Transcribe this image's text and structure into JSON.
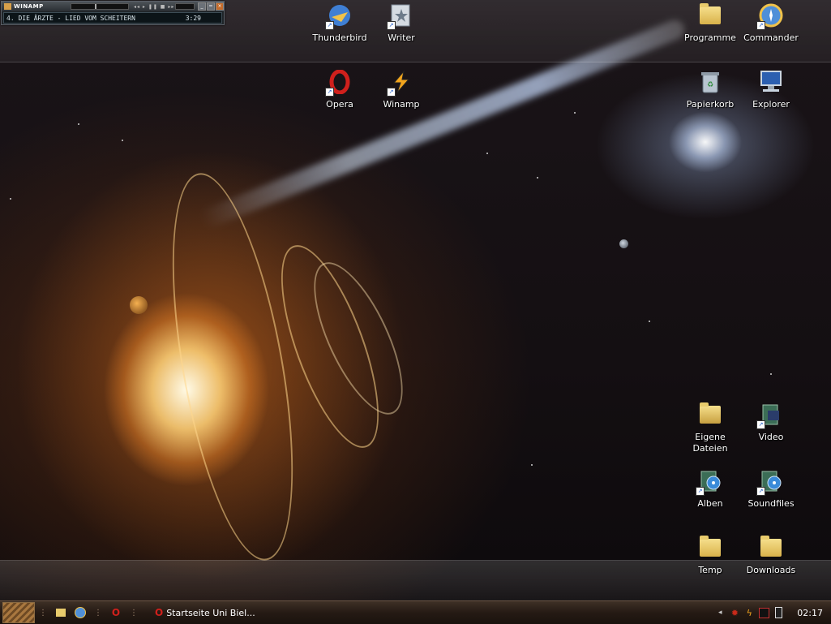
{
  "winamp": {
    "title": "WINAMP",
    "track": "4. DIE ÄRZTE - LIED VOM SCHEITERN",
    "time": "3:29"
  },
  "desktop_icons": {
    "thunderbird": "Thunderbird",
    "writer": "Writer",
    "programme": "Programme",
    "commander": "Commander",
    "opera": "Opera",
    "winamp": "Winamp",
    "papierkorb": "Papierkorb",
    "explorer": "Explorer",
    "eigene_dateien_1": "Eigene",
    "eigene_dateien_2": "Dateien",
    "video": "Video",
    "alben": "Alben",
    "soundfiles": "Soundfiles",
    "temp": "Temp",
    "downloads": "Downloads"
  },
  "taskbar": {
    "task_label": "Startseite Uni Biel...",
    "clock": "02:17"
  },
  "colors": {
    "accent": "#d9a04a",
    "taskbar": "#251a14"
  }
}
